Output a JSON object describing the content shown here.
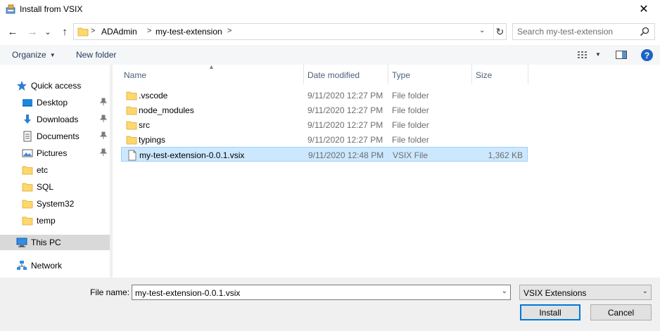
{
  "window": {
    "title": "Install from VSIX",
    "close_glyph": "✕"
  },
  "navigation": {
    "back_glyph": "←",
    "forward_glyph": "→",
    "recent_glyph": "⌄",
    "up_glyph": "↑"
  },
  "address": {
    "crumbs": [
      "ADAdmin",
      "my-test-extension"
    ],
    "separator": ">",
    "dropdown_glyph": "⌄",
    "refresh_glyph": "↻"
  },
  "search": {
    "placeholder": "Search my-test-extension",
    "value": ""
  },
  "toolbar": {
    "organize_label": "Organize",
    "new_folder_label": "New folder",
    "help_label": "?"
  },
  "sidebar": {
    "items": [
      {
        "label": "Quick access",
        "icon": "star-icon",
        "pinned": false
      },
      {
        "label": "Desktop",
        "icon": "desktop-icon",
        "pinned": true
      },
      {
        "label": "Downloads",
        "icon": "download-icon",
        "pinned": true
      },
      {
        "label": "Documents",
        "icon": "documents-icon",
        "pinned": true
      },
      {
        "label": "Pictures",
        "icon": "pictures-icon",
        "pinned": true
      },
      {
        "label": "etc",
        "icon": "folder-icon",
        "pinned": false
      },
      {
        "label": "SQL",
        "icon": "folder-icon",
        "pinned": false
      },
      {
        "label": "System32",
        "icon": "folder-icon",
        "pinned": false
      },
      {
        "label": "temp",
        "icon": "folder-icon",
        "pinned": false
      },
      {
        "label": "This PC",
        "icon": "computer-icon",
        "pinned": false,
        "selected": true
      },
      {
        "label": "Network",
        "icon": "network-icon",
        "pinned": false
      }
    ]
  },
  "file_list": {
    "columns": [
      "Name",
      "Date modified",
      "Type",
      "Size"
    ],
    "rows": [
      {
        "name": ".vscode",
        "date": "9/11/2020 12:27 PM",
        "type": "File folder",
        "size": "",
        "icon": "folder-icon"
      },
      {
        "name": "node_modules",
        "date": "9/11/2020 12:27 PM",
        "type": "File folder",
        "size": "",
        "icon": "folder-icon"
      },
      {
        "name": "src",
        "date": "9/11/2020 12:27 PM",
        "type": "File folder",
        "size": "",
        "icon": "folder-icon"
      },
      {
        "name": "typings",
        "date": "9/11/2020 12:27 PM",
        "type": "File folder",
        "size": "",
        "icon": "folder-icon"
      },
      {
        "name": "my-test-extension-0.0.1.vsix",
        "date": "9/11/2020 12:48 PM",
        "type": "VSIX File",
        "size": "1,362 KB",
        "icon": "file-icon",
        "selected": true
      }
    ]
  },
  "footer": {
    "file_name_label": "File name:",
    "file_name_value": "my-test-extension-0.0.1.vsix",
    "file_type_value": "VSIX Extensions",
    "install_label": "Install",
    "cancel_label": "Cancel"
  },
  "colors": {
    "accent": "#0078d7",
    "selection_bg": "#cce8ff",
    "selection_border": "#99d1ff",
    "folder": "#ffd76b",
    "header_text": "#4c607a"
  }
}
